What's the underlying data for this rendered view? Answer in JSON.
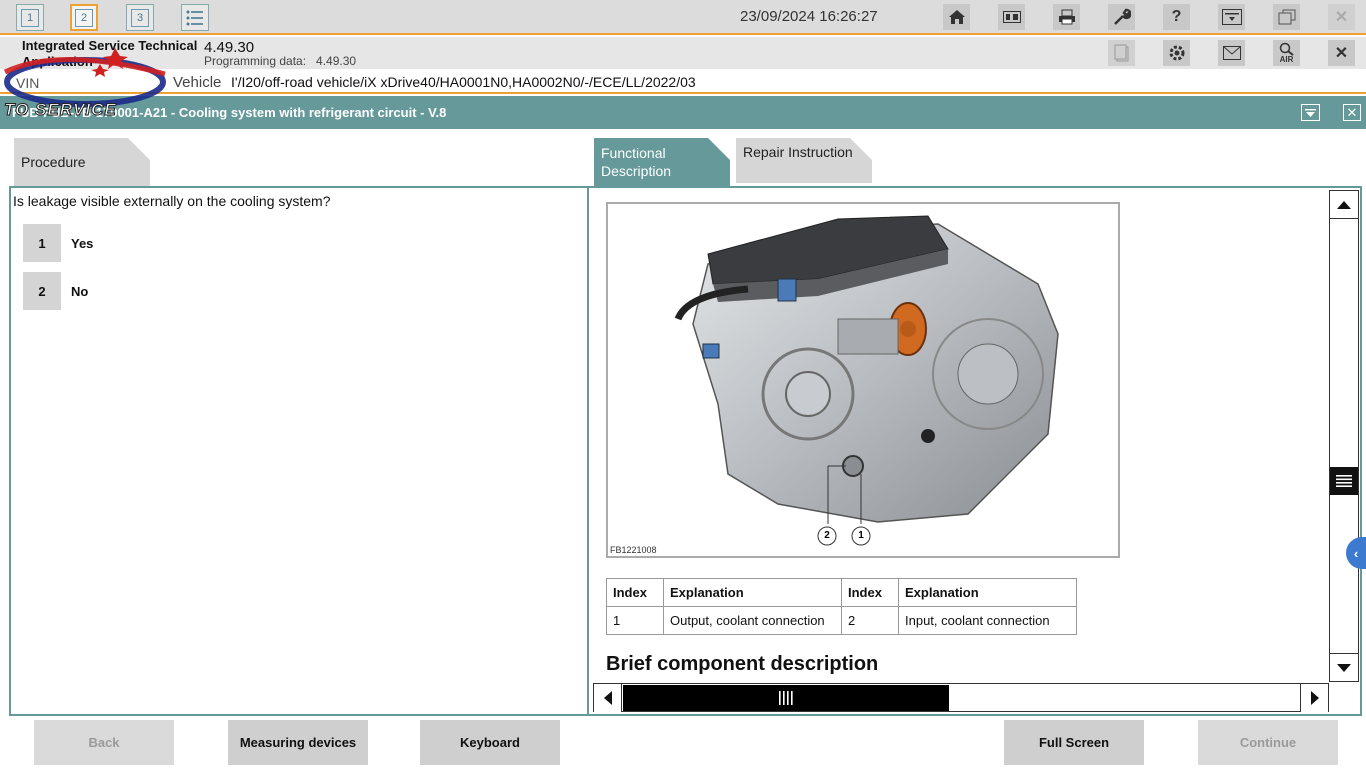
{
  "topbar": {
    "tabs": [
      "1",
      "2",
      "3"
    ],
    "datetime": "23/09/2024 16:26:27",
    "icons": [
      "home-icon",
      "vehicle-data-icon",
      "print-icon",
      "wrench-icon",
      "help-icon",
      "screen-select-icon",
      "window-restore-icon",
      "close-icon"
    ]
  },
  "info": {
    "app_name": "Integrated Service Technical Application",
    "version": "4.49.30",
    "programming_label": "Programming data:",
    "programming_value": "4.49.30",
    "icons": [
      "document-icon",
      "settings-icon",
      "mail-icon",
      "air-search-icon",
      "close-icon"
    ],
    "air_label": "AIR"
  },
  "vehicle": {
    "vin_label": "VIN",
    "label": "Vehicle",
    "value": "I'/I20/off-road vehicle/iX xDrive40/HA0001N0,HA0002N0/-/ECE/LL/2022/03"
  },
  "title": {
    "text": "FUB-FUB-FB-170001-A21 - Cooling system with refrigerant circuit - V.8"
  },
  "logo": {
    "text": "TO SERVICE"
  },
  "tabs": {
    "procedure": "Procedure",
    "functional_description": "Functional Description",
    "repair_instruction": "Repair Instruction"
  },
  "procedure": {
    "question": "Is leakage visible externally on the cooling system?",
    "answers": [
      {
        "num": "1",
        "label": "Yes"
      },
      {
        "num": "2",
        "label": "No"
      }
    ]
  },
  "document": {
    "image_code": "FB1221008",
    "callouts": [
      "2",
      "1"
    ],
    "table_headers": [
      "Index",
      "Explanation",
      "Index",
      "Explanation"
    ],
    "table_rows": [
      [
        "1",
        "Output, coolant connection",
        "2",
        "Input, coolant connection"
      ]
    ],
    "brief_heading": "Brief component description"
  },
  "buttons": {
    "back": "Back",
    "measuring_devices": "Measuring devices",
    "keyboard": "Keyboard",
    "full_screen": "Full Screen",
    "continue": "Continue"
  },
  "colors": {
    "accent_orange": "#f0a030",
    "teal": "#669999",
    "toolbar_grey": "#dcdcdc"
  }
}
